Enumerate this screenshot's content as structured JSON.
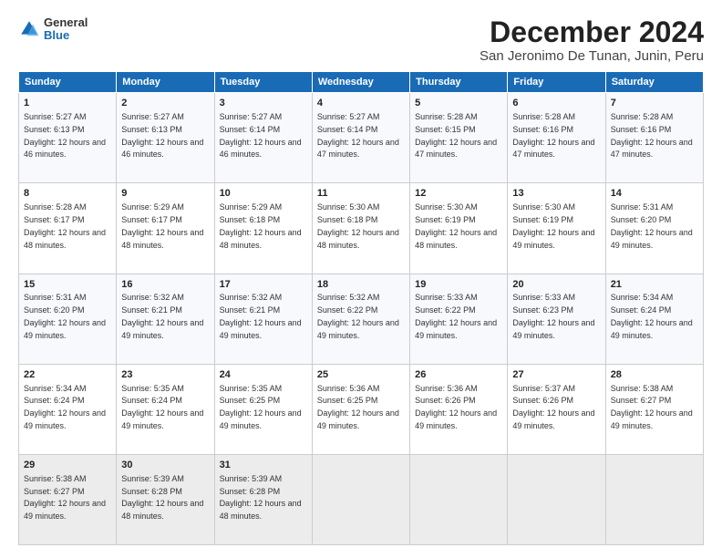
{
  "header": {
    "logo_general": "General",
    "logo_blue": "Blue",
    "title": "December 2024",
    "subtitle": "San Jeronimo De Tunan, Junin, Peru"
  },
  "days_of_week": [
    "Sunday",
    "Monday",
    "Tuesday",
    "Wednesday",
    "Thursday",
    "Friday",
    "Saturday"
  ],
  "weeks": [
    [
      {
        "day": 1,
        "sunrise": "5:27 AM",
        "sunset": "6:13 PM",
        "daylight": "12 hours and 46 minutes."
      },
      {
        "day": 2,
        "sunrise": "5:27 AM",
        "sunset": "6:13 PM",
        "daylight": "12 hours and 46 minutes."
      },
      {
        "day": 3,
        "sunrise": "5:27 AM",
        "sunset": "6:14 PM",
        "daylight": "12 hours and 46 minutes."
      },
      {
        "day": 4,
        "sunrise": "5:27 AM",
        "sunset": "6:14 PM",
        "daylight": "12 hours and 47 minutes."
      },
      {
        "day": 5,
        "sunrise": "5:28 AM",
        "sunset": "6:15 PM",
        "daylight": "12 hours and 47 minutes."
      },
      {
        "day": 6,
        "sunrise": "5:28 AM",
        "sunset": "6:16 PM",
        "daylight": "12 hours and 47 minutes."
      },
      {
        "day": 7,
        "sunrise": "5:28 AM",
        "sunset": "6:16 PM",
        "daylight": "12 hours and 47 minutes."
      }
    ],
    [
      {
        "day": 8,
        "sunrise": "5:28 AM",
        "sunset": "6:17 PM",
        "daylight": "12 hours and 48 minutes."
      },
      {
        "day": 9,
        "sunrise": "5:29 AM",
        "sunset": "6:17 PM",
        "daylight": "12 hours and 48 minutes."
      },
      {
        "day": 10,
        "sunrise": "5:29 AM",
        "sunset": "6:18 PM",
        "daylight": "12 hours and 48 minutes."
      },
      {
        "day": 11,
        "sunrise": "5:30 AM",
        "sunset": "6:18 PM",
        "daylight": "12 hours and 48 minutes."
      },
      {
        "day": 12,
        "sunrise": "5:30 AM",
        "sunset": "6:19 PM",
        "daylight": "12 hours and 48 minutes."
      },
      {
        "day": 13,
        "sunrise": "5:30 AM",
        "sunset": "6:19 PM",
        "daylight": "12 hours and 49 minutes."
      },
      {
        "day": 14,
        "sunrise": "5:31 AM",
        "sunset": "6:20 PM",
        "daylight": "12 hours and 49 minutes."
      }
    ],
    [
      {
        "day": 15,
        "sunrise": "5:31 AM",
        "sunset": "6:20 PM",
        "daylight": "12 hours and 49 minutes."
      },
      {
        "day": 16,
        "sunrise": "5:32 AM",
        "sunset": "6:21 PM",
        "daylight": "12 hours and 49 minutes."
      },
      {
        "day": 17,
        "sunrise": "5:32 AM",
        "sunset": "6:21 PM",
        "daylight": "12 hours and 49 minutes."
      },
      {
        "day": 18,
        "sunrise": "5:32 AM",
        "sunset": "6:22 PM",
        "daylight": "12 hours and 49 minutes."
      },
      {
        "day": 19,
        "sunrise": "5:33 AM",
        "sunset": "6:22 PM",
        "daylight": "12 hours and 49 minutes."
      },
      {
        "day": 20,
        "sunrise": "5:33 AM",
        "sunset": "6:23 PM",
        "daylight": "12 hours and 49 minutes."
      },
      {
        "day": 21,
        "sunrise": "5:34 AM",
        "sunset": "6:24 PM",
        "daylight": "12 hours and 49 minutes."
      }
    ],
    [
      {
        "day": 22,
        "sunrise": "5:34 AM",
        "sunset": "6:24 PM",
        "daylight": "12 hours and 49 minutes."
      },
      {
        "day": 23,
        "sunrise": "5:35 AM",
        "sunset": "6:24 PM",
        "daylight": "12 hours and 49 minutes."
      },
      {
        "day": 24,
        "sunrise": "5:35 AM",
        "sunset": "6:25 PM",
        "daylight": "12 hours and 49 minutes."
      },
      {
        "day": 25,
        "sunrise": "5:36 AM",
        "sunset": "6:25 PM",
        "daylight": "12 hours and 49 minutes."
      },
      {
        "day": 26,
        "sunrise": "5:36 AM",
        "sunset": "6:26 PM",
        "daylight": "12 hours and 49 minutes."
      },
      {
        "day": 27,
        "sunrise": "5:37 AM",
        "sunset": "6:26 PM",
        "daylight": "12 hours and 49 minutes."
      },
      {
        "day": 28,
        "sunrise": "5:38 AM",
        "sunset": "6:27 PM",
        "daylight": "12 hours and 49 minutes."
      }
    ],
    [
      {
        "day": 29,
        "sunrise": "5:38 AM",
        "sunset": "6:27 PM",
        "daylight": "12 hours and 49 minutes."
      },
      {
        "day": 30,
        "sunrise": "5:39 AM",
        "sunset": "6:28 PM",
        "daylight": "12 hours and 48 minutes."
      },
      {
        "day": 31,
        "sunrise": "5:39 AM",
        "sunset": "6:28 PM",
        "daylight": "12 hours and 48 minutes."
      },
      null,
      null,
      null,
      null
    ]
  ]
}
